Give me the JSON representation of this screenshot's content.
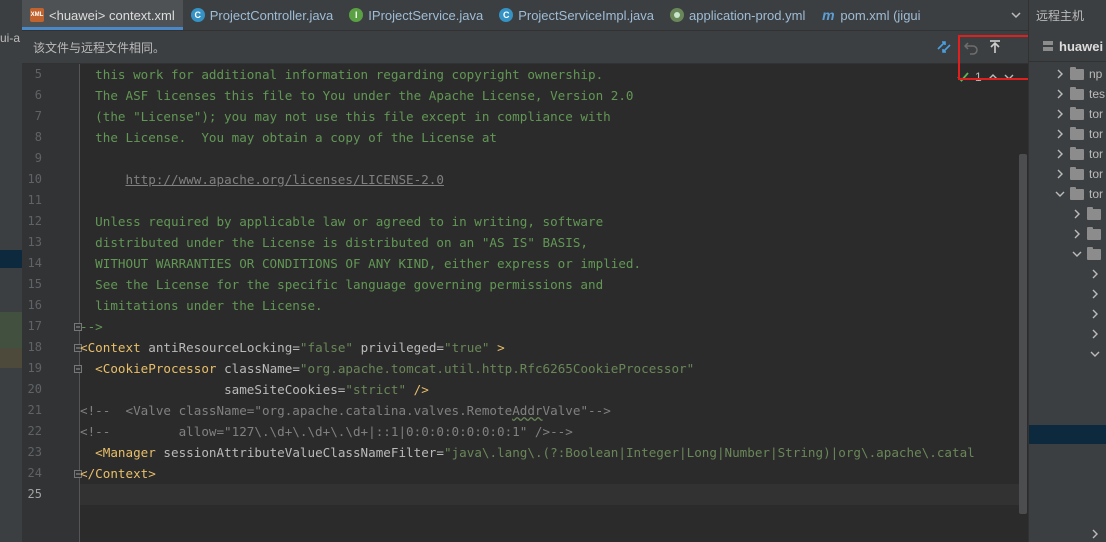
{
  "tabs": [
    {
      "label": "<huawei> context.xml",
      "icon": "xml-file-icon",
      "badge": "XML",
      "active": true
    },
    {
      "label": "ProjectController.java",
      "icon": "java-class-icon",
      "badge": "C",
      "active": false
    },
    {
      "label": "IProjectService.java",
      "icon": "java-interface-icon",
      "badge": "I",
      "active": false
    },
    {
      "label": "ProjectServiceImpl.java",
      "icon": "java-class-icon",
      "badge": "C",
      "active": false
    },
    {
      "label": "application-prod.yml",
      "icon": "yaml-file-icon",
      "badge": "",
      "active": false
    },
    {
      "label": "pom.xml (jigui",
      "icon": "maven-icon",
      "badge": "m",
      "active": false
    }
  ],
  "left_strip_text": "ui-a",
  "notice": {
    "message": "该文件与远程文件相同。"
  },
  "inspection": {
    "count": "1"
  },
  "gutter": {
    "line_numbers": [
      "5",
      "6",
      "7",
      "8",
      "9",
      "10",
      "11",
      "12",
      "13",
      "14",
      "15",
      "16",
      "17",
      "18",
      "19",
      "20",
      "21",
      "22",
      "23",
      "24",
      "25"
    ],
    "current_line": "25"
  },
  "code": {
    "l5": "  this work for additional information regarding copyright ownership.",
    "l6": "  The ASF licenses this file to You under the Apache License, Version 2.0",
    "l7": "  (the \"License\"); you may not use this file except in compliance with",
    "l8": "  the License.  You may obtain a copy of the License at",
    "l10_indent": "      ",
    "l10_url": "http://www.apache.org/licenses/LICENSE-2.0",
    "l12": "  Unless required by applicable law or agreed to in writing, software",
    "l13": "  distributed under the License is distributed on an \"AS IS\" BASIS,",
    "l14": "  WITHOUT WARRANTIES OR CONDITIONS OF ANY KIND, either express or implied.",
    "l15": "  See the License for the specific language governing permissions and",
    "l16": "  limitations under the License.",
    "l17": "-->",
    "l18": {
      "open": "<",
      "tag": "Context",
      "a1": " antiResourceLocking",
      "eq1": "=",
      "v1": "\"false\"",
      "a2": " privileged",
      "eq2": "=",
      "v2": "\"true\"",
      "close": " >"
    },
    "l19": {
      "indent": "  ",
      "open": "<",
      "tag": "CookieProcessor",
      "a1": " className",
      "eq1": "=",
      "v1": "\"org.apache.tomcat.util.http.Rfc6265CookieProcessor\""
    },
    "l20": {
      "indent": "                   ",
      "a1": "sameSiteCookies",
      "eq1": "=",
      "v1": "\"strict\"",
      "close": " />"
    },
    "l21": {
      "pre": "<!--  <Valve className=\"org.apache.catalina.valves.Remote",
      "wavy": "Addr",
      "post": "Valve\"-->"
    },
    "l22": "<!--         allow=\"127\\.\\d+\\.\\d+\\.\\d+|::1|0:0:0:0:0:0:0:1\" />-->",
    "l23": {
      "indent": "  ",
      "open": "<",
      "tag": "Manager",
      "a1": " sessionAttributeValueClassNameFilter",
      "eq1": "=",
      "v1": "\"java\\.lang\\.(?:Boolean|Integer|Long|Number|String)|org\\.apache\\.catal"
    },
    "l24": {
      "open": "</",
      "tag": "Context",
      "close": ">"
    }
  },
  "right_panel": {
    "title": "远程主机",
    "host": "huawei",
    "items": [
      {
        "label": "np",
        "expanded": false,
        "depth": 0
      },
      {
        "label": "tes",
        "expanded": false,
        "depth": 0
      },
      {
        "label": "tor",
        "expanded": false,
        "depth": 0
      },
      {
        "label": "tor",
        "expanded": false,
        "depth": 0
      },
      {
        "label": "tor",
        "expanded": false,
        "depth": 0
      },
      {
        "label": "tor",
        "expanded": false,
        "depth": 0
      },
      {
        "label": "tor",
        "expanded": true,
        "depth": 0
      },
      {
        "label": "",
        "expanded": false,
        "depth": 1
      },
      {
        "label": "",
        "expanded": false,
        "depth": 1
      },
      {
        "label": "",
        "expanded": true,
        "depth": 1
      },
      {
        "label": "",
        "expanded": false,
        "depth": 2
      },
      {
        "label": "",
        "expanded": false,
        "depth": 2
      },
      {
        "label": "",
        "expanded": false,
        "depth": 2
      },
      {
        "label": "",
        "expanded": false,
        "depth": 2
      },
      {
        "label": "",
        "expanded": true,
        "depth": 2
      }
    ]
  },
  "colors": {
    "highlight_box": "#e0201f",
    "active_tab_underline": "#4a88c7",
    "comment": "#629755",
    "tag": "#e8bf6a",
    "attr_value": "#6a8759"
  }
}
